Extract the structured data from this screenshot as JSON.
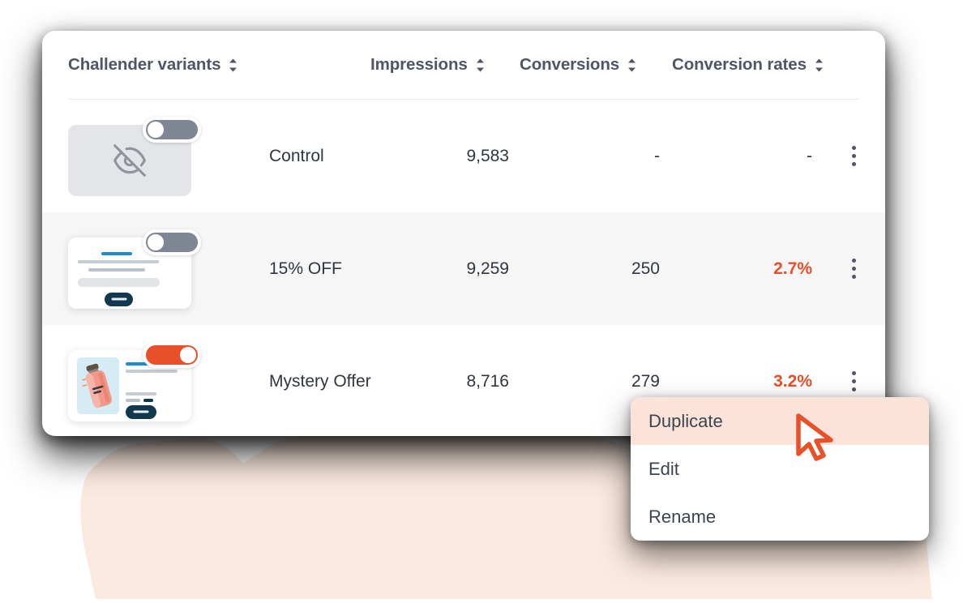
{
  "table": {
    "columns": [
      {
        "label": "Challender variants",
        "sort_icon": "sort-updown-icon"
      },
      {
        "label": "Impressions",
        "sort_icon": "sort-updown-icon"
      },
      {
        "label": "Conversions",
        "sort_icon": "sort-updown-icon"
      },
      {
        "label": "Conversion rates",
        "sort_icon": "sort-updown-icon"
      }
    ],
    "rows": [
      {
        "name": "Control",
        "impressions": "9,583",
        "conversions": "-",
        "conversion_rate": "-",
        "toggle_state": "off",
        "thumbnail": "hidden-eye-off-thumbnail",
        "menu_icon": "kebab-menu-icon"
      },
      {
        "name": "15% OFF",
        "impressions": "9,259",
        "conversions": "250",
        "conversion_rate": "2.7%",
        "toggle_state": "off",
        "thumbnail": "landing-page-mock-thumbnail",
        "menu_icon": "kebab-menu-icon"
      },
      {
        "name": "Mystery Offer",
        "impressions": "8,716",
        "conversions": "279",
        "conversion_rate": "3.2%",
        "toggle_state": "on",
        "thumbnail": "product-landing-page-thumbnail",
        "menu_icon": "kebab-menu-icon"
      }
    ]
  },
  "context_menu": {
    "items": [
      {
        "label": "Duplicate",
        "state": "hovered"
      },
      {
        "label": "Edit",
        "state": "default"
      },
      {
        "label": "Rename",
        "state": "default"
      }
    ]
  },
  "cursor": {
    "icon": "arrow-pointer-cursor"
  },
  "colors": {
    "accent_orange": "#E8502A",
    "toggle_off_gray": "#7F8794",
    "menu_hover_peach": "#FBE3DA",
    "row_alt_gray": "#F6F6F6",
    "header_text": "#4E5665",
    "body_text": "#303640",
    "blob_peach": "#FBEADF",
    "thumb_accent_blue": "#1F8AD4",
    "thumb_button_navy": "#12384F",
    "product_box_blue": "#D6ECF5"
  }
}
